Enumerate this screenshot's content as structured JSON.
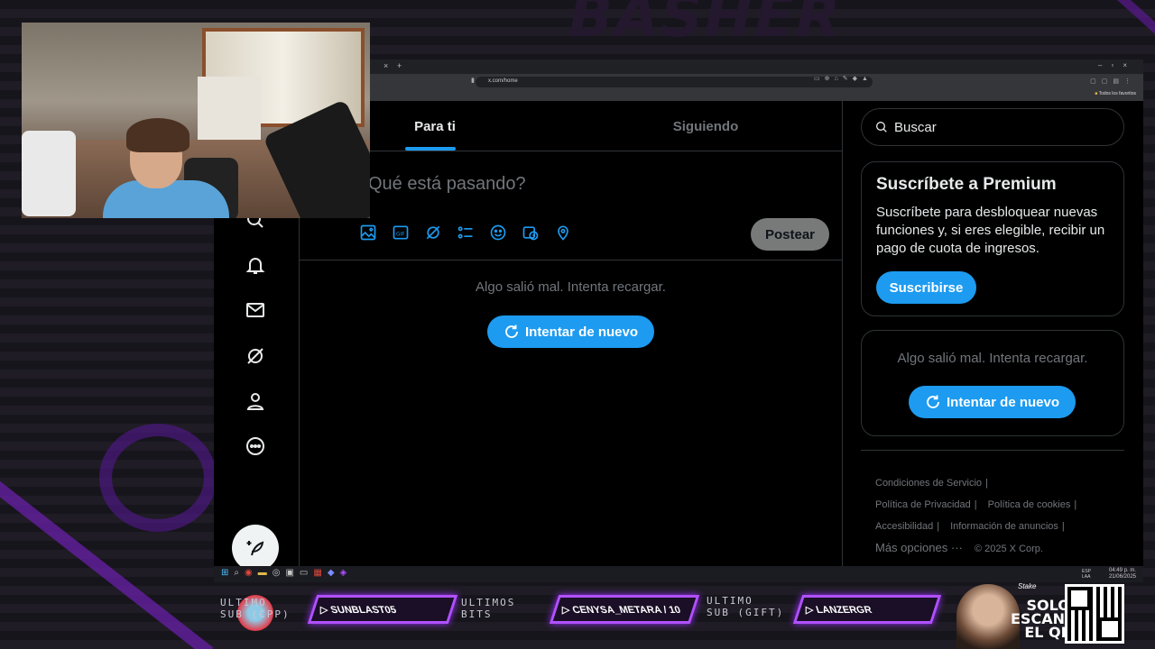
{
  "overlay": {
    "logo_text": "BASHER",
    "stream_bar": {
      "last_sub_label_1": "ULTIMO",
      "last_sub_label_2": "SUB (CPP)",
      "last_sub_name": "SUNBLAST05",
      "last_bits_label_1": "ULTIMOS",
      "last_bits_label_2": "BITS",
      "last_bits_name": "CENYSA_METARA / 10",
      "last_gift_label_1": "ULTIMO",
      "last_gift_label_2": "SUB (GIFT)",
      "last_gift_name": "LANZERGR",
      "qr_text_1": "SOLO",
      "qr_text_2": "ESCANEA",
      "qr_text_3": "EL QR",
      "stake_label": "Stake"
    },
    "accent_color": "#b150ff"
  },
  "browser": {
    "url": "x.com/home",
    "bookmarks_folder": "Todos los favoritos",
    "tab_close": "×",
    "tab_new": "+"
  },
  "feed": {
    "tabs": [
      {
        "label": "Para ti",
        "active": true
      },
      {
        "label": "Siguiendo",
        "active": false
      }
    ],
    "composer_placeholder": "Qué está pasando?",
    "post_button": "Postear",
    "error_text": "Algo salió mal. Intenta recargar.",
    "retry_button": "Intentar de nuevo"
  },
  "sidebar_icons": [
    "search-icon",
    "bell-icon",
    "mail-icon",
    "grok-icon",
    "profile-icon",
    "more-icon",
    "compose-icon"
  ],
  "right": {
    "search_placeholder": "Buscar",
    "premium": {
      "title": "Suscríbete a Premium",
      "body": "Suscríbete para desbloquear nuevas funciones y, si eres elegible, recibir un pago de cuota de ingresos.",
      "button": "Suscribirse"
    },
    "trends_error": "Algo salió mal. Intenta recargar.",
    "trends_retry": "Intentar de nuevo",
    "footer": {
      "terms": "Condiciones de Servicio",
      "privacy": "Política de Privacidad",
      "cookies": "Política de cookies",
      "accessibility": "Accesibilidad",
      "ads_info": "Información de anuncios",
      "more": "Más opciones ···",
      "copyright": "© 2025 X Corp."
    }
  },
  "taskbar": {
    "lang_1": "ESP",
    "lang_2": "LAA",
    "time": "04:49 p. m.",
    "date": "21/06/2025"
  },
  "colors": {
    "accent_blue": "#1d9bf0",
    "background": "#000000",
    "border": "#2f3336",
    "muted_text": "#71767b"
  }
}
